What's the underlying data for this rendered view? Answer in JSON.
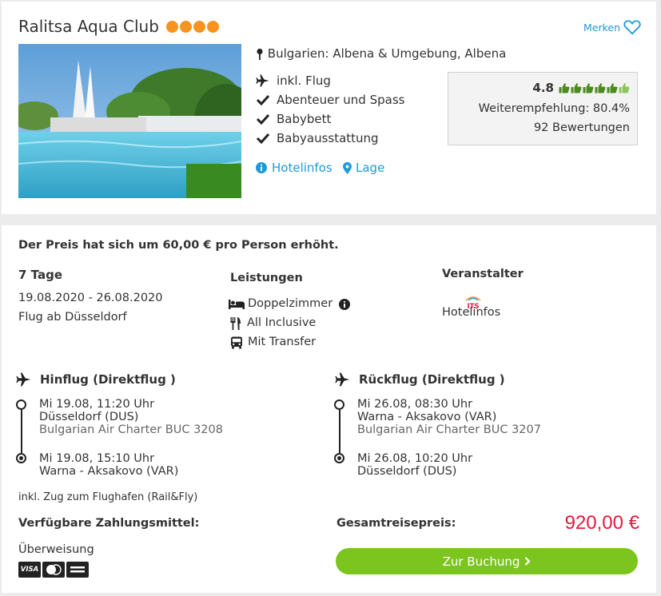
{
  "hotel": {
    "name": "Ralitsa Aqua Club",
    "star_count": 4,
    "star_color": "#f7931e",
    "save_label": "Merken",
    "location": "Bulgarien: Albena & Umgebung, Albena",
    "features": [
      "inkl. Flug",
      "Abenteuer und Spass",
      "Babybett",
      "Babyausstattung"
    ],
    "links": {
      "info": "Hotelinfos",
      "location": "Lage"
    },
    "rating": {
      "score": "4.8",
      "thumbs_filled": 6,
      "thumbs_total": 6,
      "recommendation": "Weiterempfehlung: 80.4%",
      "reviews": "92 Bewertungen"
    }
  },
  "offer": {
    "price_notice": "Der Preis hat sich um 60,00 € pro Person erhöht.",
    "duration": "7 Tage",
    "dates": "19.08.2020 - 26.08.2020",
    "departure": "Flug ab Düsseldorf",
    "services_heading": "Leistungen",
    "services": [
      "Doppelzimmer",
      "All Inclusive",
      "Mit Transfer"
    ],
    "operator_heading": "Veranstalter",
    "operator_logo": "ITS",
    "operator_link": "Hotelinfos",
    "outbound": {
      "title": "Hinflug (Direktflug )",
      "dep_time": "Mi 19.08, 11:20 Uhr",
      "dep_airport": "Düsseldorf (DUS)",
      "carrier": "Bulgarian Air Charter BUC 3208",
      "arr_time": "Mi 19.08, 15:10 Uhr",
      "arr_airport": "Warna - Aksakovo (VAR)"
    },
    "return": {
      "title": "Rückflug (Direktflug )",
      "dep_time": "Mi 26.08, 08:30 Uhr",
      "dep_airport": "Warna - Aksakovo (VAR)",
      "carrier": "Bulgarian Air Charter BUC 3207",
      "arr_time": "Mi 26.08, 10:20 Uhr",
      "arr_airport": "Düsseldorf (DUS)"
    },
    "rail_note": "inkl. Zug zum Flughafen (Rail&Fly)",
    "payment_heading": "Verfügbare Zahlungsmittel:",
    "payment_method": "Überweisung",
    "card_logos": [
      "VISA"
    ],
    "total_label": "Gesamtreisepreis:",
    "total_price": "920,00 €",
    "book_button": "Zur Buchung"
  },
  "colors": {
    "accent": "#1e9ad6",
    "price_red": "#e6183c",
    "book_green": "#7cc41e",
    "thumb_green": "#4b8a1c",
    "star_orange": "#f7931e"
  }
}
